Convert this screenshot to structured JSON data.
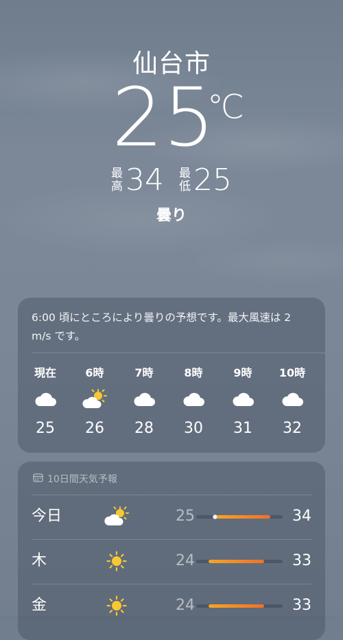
{
  "location": {
    "city": "仙台市",
    "current_temp": "25",
    "unit": "℃",
    "high_label_1": "最",
    "high_label_2": "高",
    "high": "34",
    "low_label_1": "最",
    "low_label_2": "低",
    "low": "25",
    "condition": "曇り"
  },
  "hourly": {
    "summary": "6:00 頃にところにより曇りの予想です。最大風速は 2 m/s です。",
    "items": [
      {
        "label": "現在",
        "icon": "cloud-icon",
        "temp": "25"
      },
      {
        "label": "6時",
        "icon": "partly-sunny-icon",
        "temp": "26"
      },
      {
        "label": "7時",
        "icon": "cloud-icon",
        "temp": "28"
      },
      {
        "label": "8時",
        "icon": "cloud-icon",
        "temp": "30"
      },
      {
        "label": "9時",
        "icon": "cloud-icon",
        "temp": "31"
      },
      {
        "label": "10時",
        "icon": "cloud-icon",
        "temp": "32"
      }
    ]
  },
  "daily": {
    "title": "10日間天気予報",
    "title_icon": "calendar-icon",
    "range_min": 22,
    "range_max": 36,
    "current_temp_value": 25,
    "bar_color_start": "#f5a623",
    "bar_color_end": "#f0702a",
    "days": [
      {
        "day": "今日",
        "icon": "partly-sunny-icon",
        "low": "25",
        "high": "34"
      },
      {
        "day": "木",
        "icon": "sun-icon",
        "low": "24",
        "high": "33"
      },
      {
        "day": "金",
        "icon": "sun-icon",
        "low": "24",
        "high": "33"
      }
    ]
  }
}
